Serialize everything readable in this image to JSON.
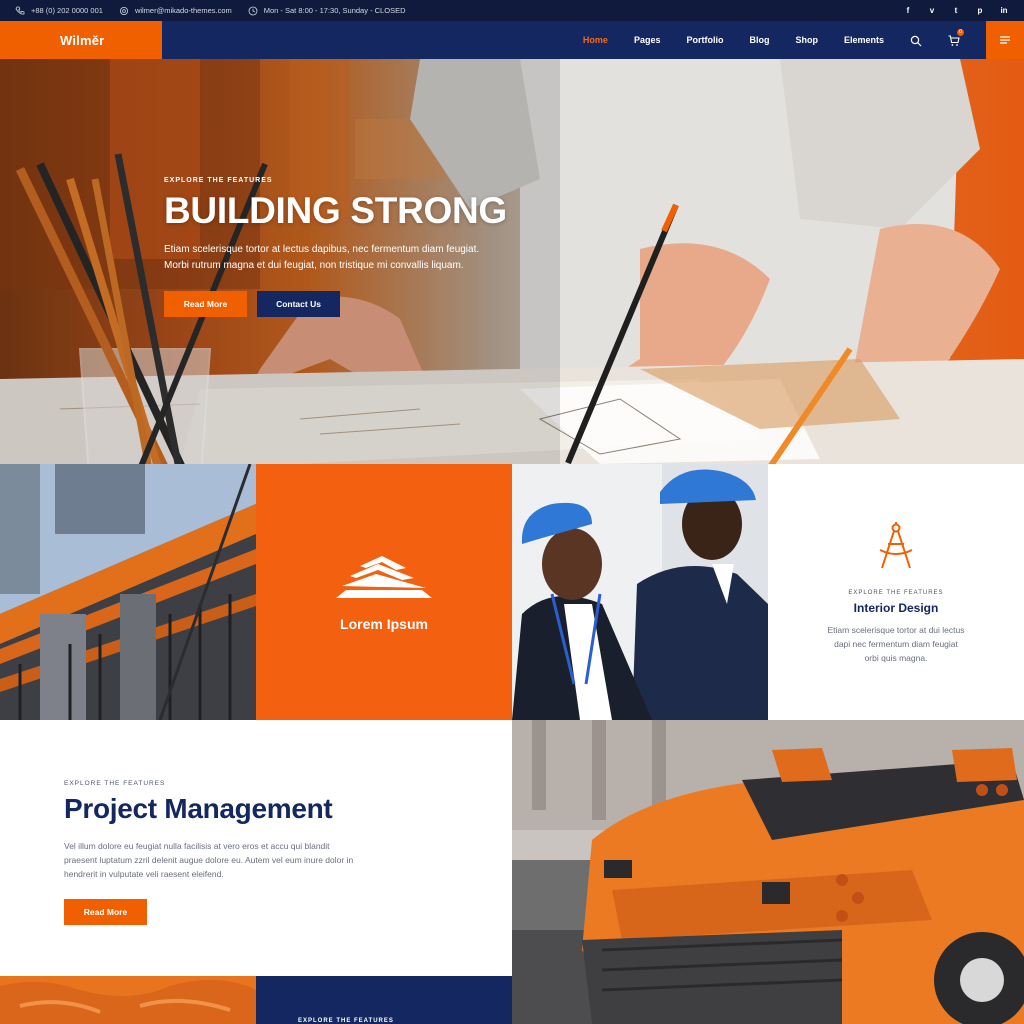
{
  "topbar": {
    "phone": "+88 (0) 202 0000 001",
    "email": "wilmer@mikado-themes.com",
    "hours": "Mon - Sat 8:00 - 17:30, Sunday - CLOSED",
    "social": [
      "f",
      "v",
      "t",
      "p",
      "in"
    ]
  },
  "nav": {
    "logo": "Wilmĕr",
    "items": [
      "Home",
      "Pages",
      "Portfolio",
      "Blog",
      "Shop",
      "Elements"
    ],
    "active_item": "Home",
    "cart_count": "0"
  },
  "hero": {
    "kicker": "EXPLORE THE FEATURES",
    "title": "BUILDING STRONG",
    "text": "Etiam scelerisque tortor at lectus dapibus, nec fermentum diam feugiat. Morbi rutrum magna et dui feugiat, non tristique mi convallis liquam.",
    "primary_button": "Read More",
    "secondary_button": "Contact Us"
  },
  "brand_tile": {
    "label": "Lorem Ipsum"
  },
  "interior": {
    "kicker": "EXPLORE THE FEATURES",
    "title": "Interior Design",
    "text": "Etiam scelerisque tortor at dui lectus dapi nec fermentum diam feugiat orbi quis magna."
  },
  "project": {
    "kicker": "EXPLORE THE FEATURES",
    "title": "Project Management",
    "text": "Vel illum dolore eu feugiat nulla facilisis at vero eros et accu qui blandit praesent luptatum zzril delenit augue dolore eu. Autem vel eum inure dolor in hendrerit in vulputate veli raesent eleifend.",
    "button": "Read More"
  },
  "bottom": {
    "kicker": "EXPLORE THE FEATURES"
  },
  "colors": {
    "accent": "#f06000",
    "navy": "#142760",
    "dark": "#0f1a3c"
  },
  "icons": [
    "phone-icon",
    "email-icon",
    "clock-icon",
    "search-icon",
    "cart-icon",
    "menu-icon",
    "drafting-compass-icon",
    "building-logo-icon"
  ]
}
